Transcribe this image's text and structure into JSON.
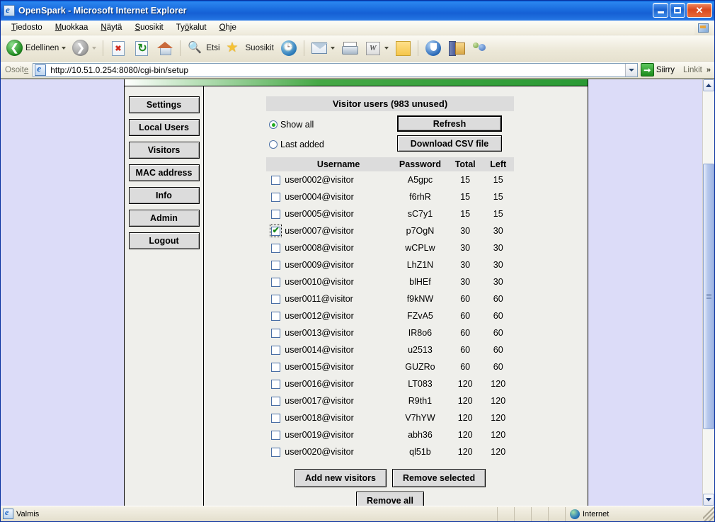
{
  "window": {
    "title": "OpenSpark - Microsoft Internet Explorer",
    "minimize_label": "Minimize",
    "maximize_label": "Maximize",
    "close_label": "Close"
  },
  "menu": {
    "items": [
      {
        "label": "Tiedosto",
        "accel": "T",
        "rest": "iedosto"
      },
      {
        "label": "Muokkaa",
        "accel": "M",
        "rest": "uokkaa"
      },
      {
        "label": "Näytä",
        "accel": "N",
        "rest": "äytä"
      },
      {
        "label": "Suosikit",
        "accel": "S",
        "rest": "uosikit"
      },
      {
        "label": "Työkalut",
        "accel": "T",
        "rest": "yökalut"
      },
      {
        "label": "Ohje",
        "accel": "O",
        "rest": "hje"
      }
    ]
  },
  "toolbar": {
    "back_label": "Edellinen",
    "forward_label": "",
    "stop_label": "Stop",
    "refresh_label": "Refresh",
    "home_label": "Home",
    "search_label": "Etsi",
    "favorites_label": "Suosikit",
    "history_label": "History",
    "mail_label": "Mail",
    "print_label": "Print",
    "edit_label": "Edit",
    "word_icon_text": "W",
    "notes_label": "Notes",
    "messenger_label": "Messenger",
    "research_label": "Research",
    "discuss_label": "Discuss"
  },
  "address": {
    "label": "Osoite",
    "label_accel": "e",
    "url": "http://10.51.0.254:8080/cgi-bin/setup",
    "go_label": "Siirry",
    "links_label": "Linkit",
    "chevron": "»"
  },
  "sidebar": {
    "items": [
      {
        "label": "Settings"
      },
      {
        "label": "Local Users"
      },
      {
        "label": "Visitors"
      },
      {
        "label": "MAC address"
      },
      {
        "label": "Info"
      },
      {
        "label": "Admin"
      },
      {
        "label": "Logout"
      }
    ]
  },
  "main": {
    "panel_title": "Visitor users (983 unused)",
    "unused_count": 983,
    "radio_options": [
      {
        "label": "Show all",
        "selected": true
      },
      {
        "label": "Last added",
        "selected": false
      }
    ],
    "action_buttons": [
      {
        "label": "Refresh",
        "focused": true
      },
      {
        "label": "Download CSV file",
        "focused": false
      }
    ],
    "table": {
      "columns": [
        "",
        "Username",
        "Password",
        "Total",
        "Left"
      ],
      "rows": [
        {
          "checked": false,
          "focused": false,
          "username": "user0002@visitor",
          "password": "A5gpc",
          "total": "15",
          "left": "15"
        },
        {
          "checked": false,
          "focused": false,
          "username": "user0004@visitor",
          "password": "f6rhR",
          "total": "15",
          "left": "15"
        },
        {
          "checked": false,
          "focused": false,
          "username": "user0005@visitor",
          "password": "sC7y1",
          "total": "15",
          "left": "15"
        },
        {
          "checked": true,
          "focused": true,
          "username": "user0007@visitor",
          "password": "p7OgN",
          "total": "30",
          "left": "30"
        },
        {
          "checked": false,
          "focused": false,
          "username": "user0008@visitor",
          "password": "wCPLw",
          "total": "30",
          "left": "30"
        },
        {
          "checked": false,
          "focused": false,
          "username": "user0009@visitor",
          "password": "LhZ1N",
          "total": "30",
          "left": "30"
        },
        {
          "checked": false,
          "focused": false,
          "username": "user0010@visitor",
          "password": "blHEf",
          "total": "30",
          "left": "30"
        },
        {
          "checked": false,
          "focused": false,
          "username": "user0011@visitor",
          "password": "f9kNW",
          "total": "60",
          "left": "60"
        },
        {
          "checked": false,
          "focused": false,
          "username": "user0012@visitor",
          "password": "FZvA5",
          "total": "60",
          "left": "60"
        },
        {
          "checked": false,
          "focused": false,
          "username": "user0013@visitor",
          "password": "IR8o6",
          "total": "60",
          "left": "60"
        },
        {
          "checked": false,
          "focused": false,
          "username": "user0014@visitor",
          "password": "u2513",
          "total": "60",
          "left": "60"
        },
        {
          "checked": false,
          "focused": false,
          "username": "user0015@visitor",
          "password": "GUZRo",
          "total": "60",
          "left": "60"
        },
        {
          "checked": false,
          "focused": false,
          "username": "user0016@visitor",
          "password": "LT083",
          "total": "120",
          "left": "120"
        },
        {
          "checked": false,
          "focused": false,
          "username": "user0017@visitor",
          "password": "R9th1",
          "total": "120",
          "left": "120"
        },
        {
          "checked": false,
          "focused": false,
          "username": "user0018@visitor",
          "password": "V7hYW",
          "total": "120",
          "left": "120"
        },
        {
          "checked": false,
          "focused": false,
          "username": "user0019@visitor",
          "password": "abh36",
          "total": "120",
          "left": "120"
        },
        {
          "checked": false,
          "focused": false,
          "username": "user0020@visitor",
          "password": "ql51b",
          "total": "120",
          "left": "120"
        }
      ]
    },
    "bottom_buttons": [
      {
        "label": "Add new visitors"
      },
      {
        "label": "Remove selected"
      }
    ],
    "bottom_buttons_row2": [
      {
        "label": "Remove all"
      }
    ]
  },
  "statusbar": {
    "text": "Valmis",
    "zone": "Internet"
  },
  "colors": {
    "title_blue": "#1560d4",
    "accent_green": "#2a9a34",
    "frame_margin": "#dcdcf8",
    "button_face": "#dcdcdc",
    "content_bg": "#efefeb"
  }
}
